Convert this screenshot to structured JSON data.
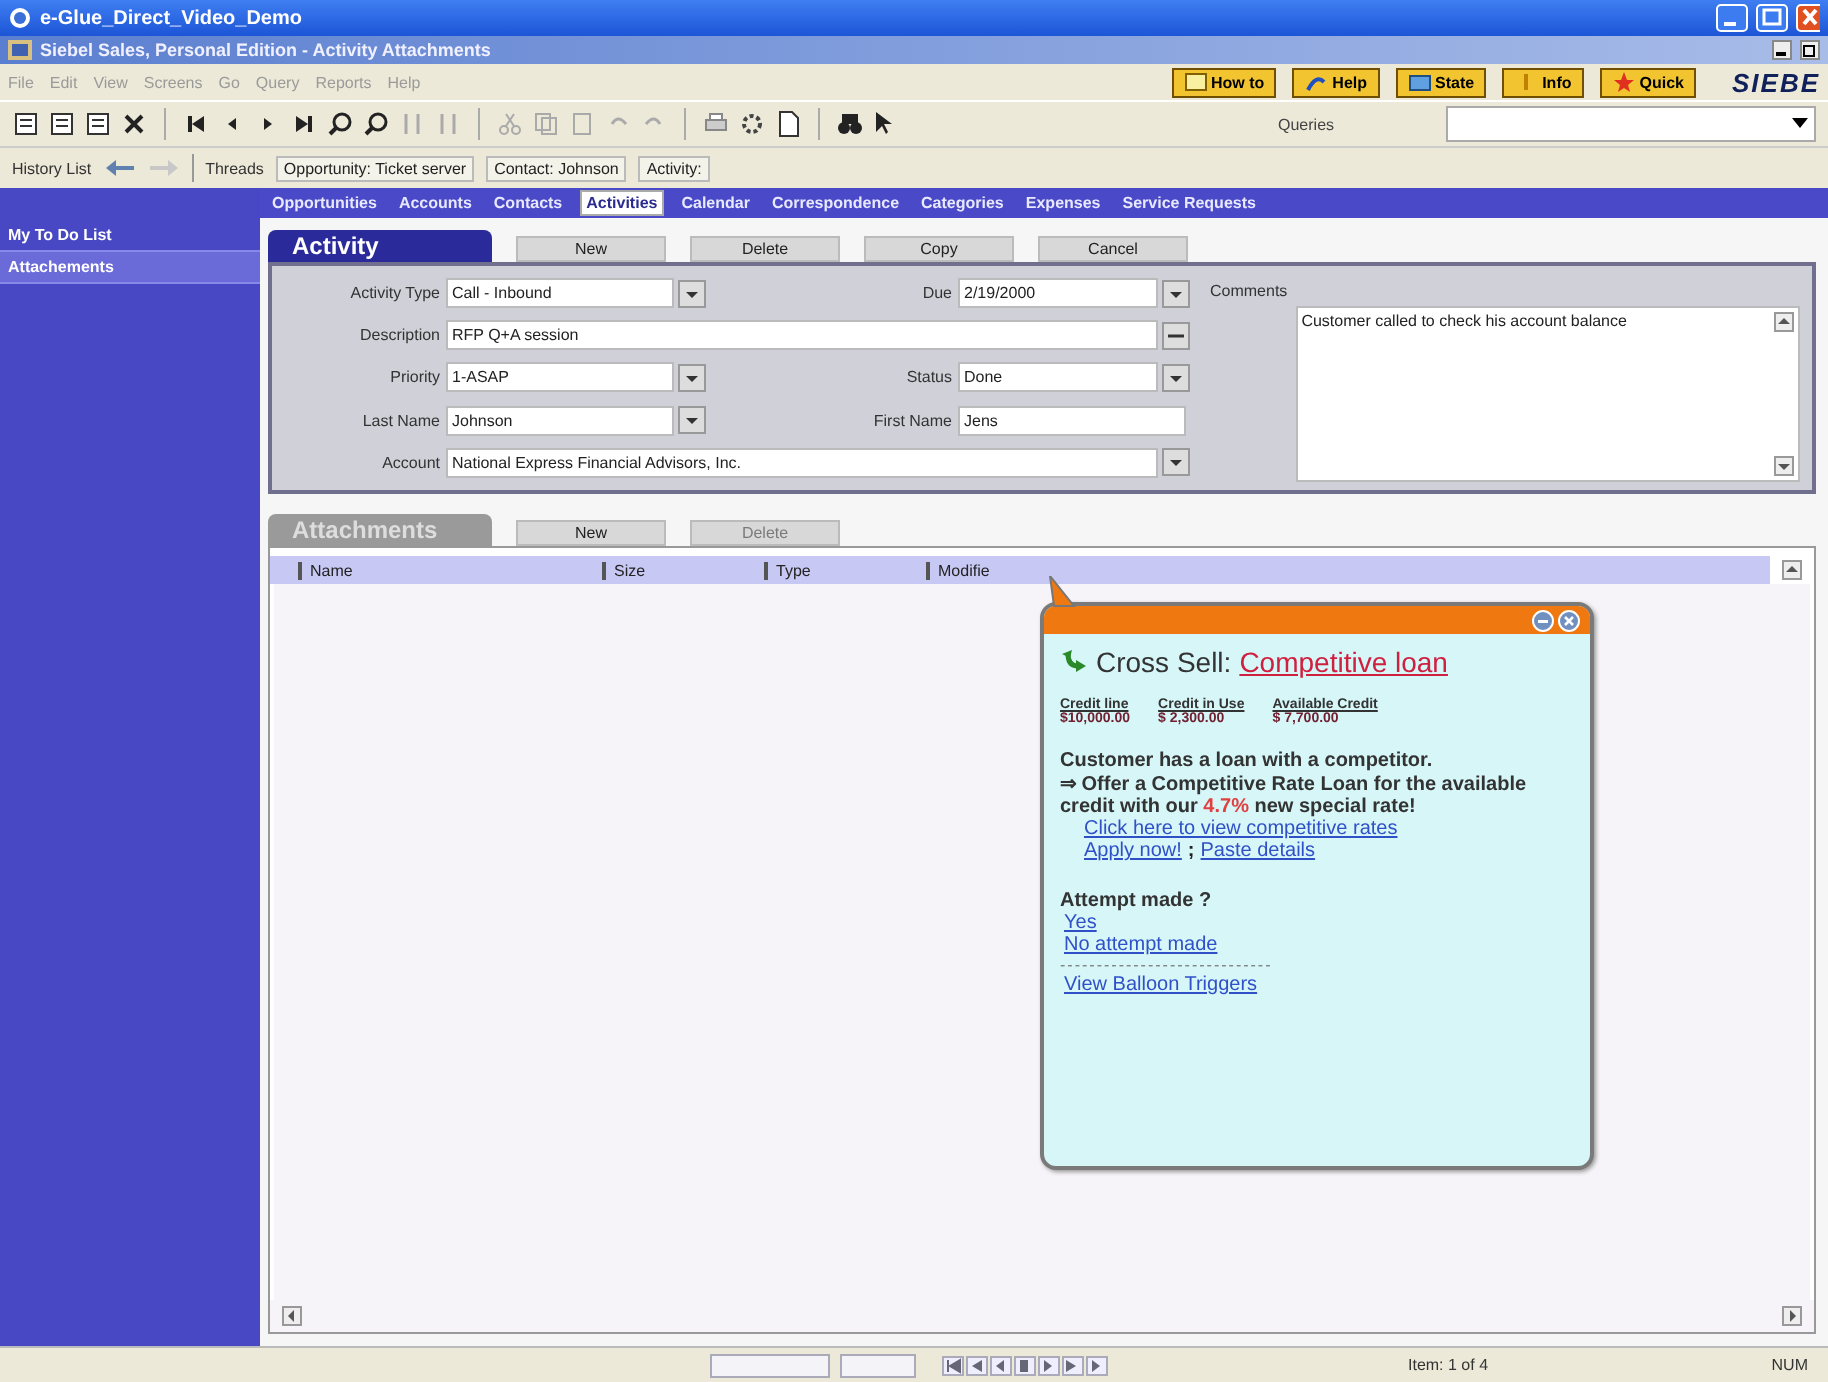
{
  "window": {
    "title": "e-Glue_Direct_Video_Demo"
  },
  "app": {
    "title": "Siebel Sales, Personal Edition - Activity Attachments"
  },
  "menu": [
    "File",
    "Edit",
    "View",
    "Screens",
    "Go",
    "Query",
    "Reports",
    "Help"
  ],
  "quick_buttons": [
    "How to",
    "Help",
    "State",
    "Info",
    "Quick"
  ],
  "logo": "SIEBE",
  "toolbar": {
    "queries_label": "Queries"
  },
  "history": {
    "label": "History List",
    "threads_label": "Threads",
    "items": [
      "Opportunity: Ticket server",
      "Contact: Johnson",
      "Activity:"
    ]
  },
  "sidebar": {
    "items": [
      {
        "label": "My To Do List",
        "selected": false
      },
      {
        "label": "Attachements",
        "selected": true
      }
    ]
  },
  "screen_tabs": [
    {
      "label": "Opportunities",
      "selected": false
    },
    {
      "label": "Accounts",
      "selected": false
    },
    {
      "label": "Contacts",
      "selected": false
    },
    {
      "label": "Activities",
      "selected": true
    },
    {
      "label": "Calendar",
      "selected": false
    },
    {
      "label": "Correspondence",
      "selected": false
    },
    {
      "label": "Categories",
      "selected": false
    },
    {
      "label": "Expenses",
      "selected": false
    },
    {
      "label": "Service Requests",
      "selected": false
    }
  ],
  "activity": {
    "title": "Activity",
    "active": true,
    "buttons": [
      {
        "label": "New",
        "disabled": false
      },
      {
        "label": "Delete",
        "disabled": false
      },
      {
        "label": "Copy",
        "disabled": false
      },
      {
        "label": "Cancel",
        "disabled": false
      }
    ],
    "rows": [
      [
        {
          "label": "Activity Type",
          "value": "Call - Inbound",
          "kind": "dropdown"
        },
        {
          "label": "Due",
          "value": "2/19/2000",
          "kind": "dropdown"
        }
      ],
      [
        {
          "label": "Description",
          "value": "RFP Q+A session",
          "kind": "expand"
        }
      ],
      [
        {
          "label": "Priority",
          "value": "1-ASAP",
          "kind": "dropdown"
        },
        {
          "label": "Status",
          "value": "Done",
          "kind": "dropdown"
        }
      ],
      [
        {
          "label": "Last Name",
          "value": "Johnson",
          "kind": "dropdown"
        },
        {
          "label": "First Name",
          "value": "Jens",
          "kind": "text"
        }
      ],
      [
        {
          "label": "Account",
          "value": "National Express Financial Advisors, Inc.",
          "kind": "dropdown"
        }
      ]
    ],
    "comments": {
      "label": "Comments",
      "value": "Customer called to check his account balance"
    }
  },
  "attachments": {
    "title": "Attachments",
    "active": false,
    "buttons": [
      {
        "label": "New",
        "disabled": false
      },
      {
        "label": "Delete",
        "disabled": true
      }
    ],
    "columns": [
      "Name",
      "Size",
      "Type",
      "Modifie"
    ]
  },
  "balloon": {
    "title": "Cross Sell:",
    "title_link": "Competitive loan",
    "credit": [
      {
        "label": "Credit line",
        "value": "$10,000.00"
      },
      {
        "label": "Credit in Use",
        "value": "$ 2,300.00"
      },
      {
        "label": "Available Credit",
        "value": "$ 7,700.00"
      }
    ],
    "message": [
      "Customer has a loan with a competitor.",
      "⇒ Offer a Competitive Rate Loan for the available"
    ],
    "offer": {
      "before": "credit with our",
      "rate": "4.7%",
      "after": "new special rate!"
    },
    "links": [
      "Click here to view competitive rates"
    ],
    "apply": {
      "link": "Apply now!",
      "separator": ";",
      "paste": "Paste details"
    },
    "attempt": {
      "label": "Attempt made ?",
      "options": [
        "Yes",
        "No attempt made"
      ]
    },
    "separator": "-----------------------------",
    "footer_link": "View Balloon Triggers"
  },
  "status_bar": {
    "item_count": "Item: 1 of 4",
    "num": "NUM"
  }
}
